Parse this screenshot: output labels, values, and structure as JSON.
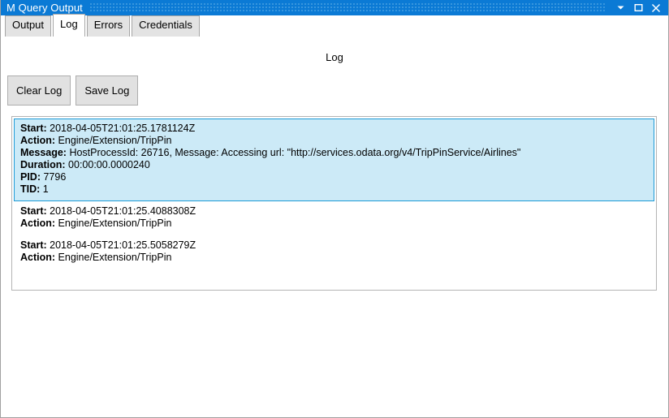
{
  "window": {
    "title": "M Query Output",
    "controls": [
      {
        "name": "minimize",
        "glyph": "chevron-down"
      },
      {
        "name": "maximize",
        "glyph": "square"
      },
      {
        "name": "close",
        "glyph": "x"
      }
    ]
  },
  "tabs": [
    {
      "label": "Output",
      "active": false
    },
    {
      "label": "Log",
      "active": true
    },
    {
      "label": "Errors",
      "active": false
    },
    {
      "label": "Credentials",
      "active": false
    }
  ],
  "page": {
    "heading": "Log"
  },
  "toolbar": {
    "clear_label": "Clear Log",
    "save_label": "Save Log"
  },
  "log": {
    "entries": [
      {
        "selected": true,
        "lines": [
          {
            "key": "Start:",
            "value": "2018-04-05T21:01:25.1781124Z"
          },
          {
            "key": "Action:",
            "value": "Engine/Extension/TripPin"
          },
          {
            "key": "Message:",
            "value": "HostProcessId: 26716, Message: Accessing url: \"http://services.odata.org/v4/TripPinService/Airlines\""
          },
          {
            "key": "Duration:",
            "value": "00:00:00.0000240"
          },
          {
            "key": "PID:",
            "value": "7796"
          },
          {
            "key": "TID:",
            "value": "1"
          }
        ]
      },
      {
        "selected": false,
        "lines": [
          {
            "key": "Start:",
            "value": "2018-04-05T21:01:25.4088308Z"
          },
          {
            "key": "Action:",
            "value": "Engine/Extension/TripPin"
          }
        ]
      },
      {
        "selected": false,
        "lines": [
          {
            "key": "Start:",
            "value": "2018-04-05T21:01:25.5058279Z"
          },
          {
            "key": "Action:",
            "value": "Engine/Extension/TripPin"
          }
        ]
      }
    ]
  },
  "colors": {
    "titlebar": "#0b7ad5",
    "selection_bg": "#cceaf7",
    "selection_border": "#1e9bd7",
    "button_face": "#e1e1e1"
  }
}
